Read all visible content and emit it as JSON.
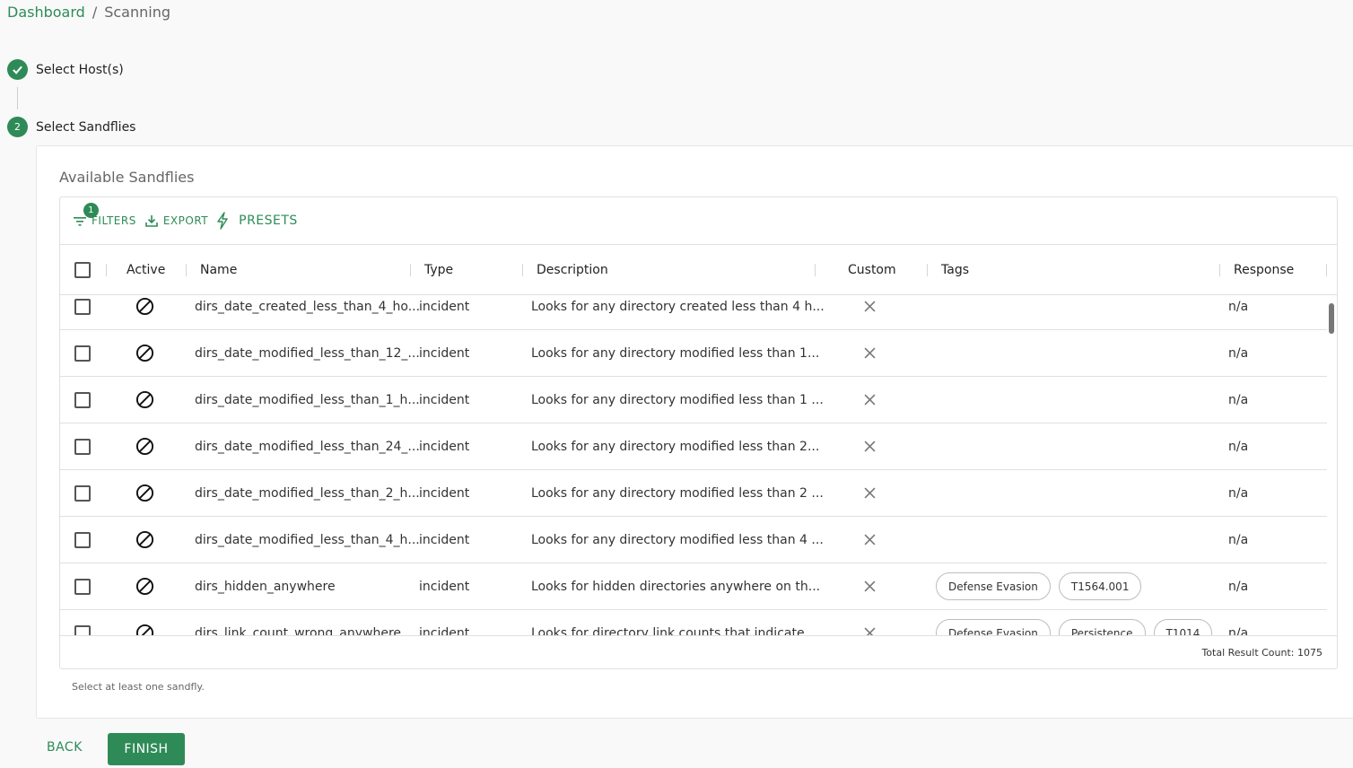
{
  "breadcrumb": {
    "link": "Dashboard",
    "separator": "/",
    "current": "Scanning"
  },
  "steps": [
    {
      "number": "",
      "label": "Select Host(s)",
      "status": "completed"
    },
    {
      "number": "2",
      "label": "Select Sandflies",
      "status": "active"
    }
  ],
  "panel": {
    "title": "Available Sandflies",
    "hint": "Select at least one sandfly."
  },
  "toolbar": {
    "filters_label": "FILTERS",
    "filters_badge": "1",
    "export_label": "EXPORT",
    "presets_label": "PRESETS"
  },
  "columns": {
    "active": "Active",
    "name": "Name",
    "type": "Type",
    "description": "Description",
    "custom": "Custom",
    "tags": "Tags",
    "response": "Response"
  },
  "rows": [
    {
      "active_icon": "disabled-icon",
      "name": "dirs_date_created_less_than_4_ho...",
      "type": "incident",
      "description": "Looks for any directory created less than 4 h...",
      "custom_icon": "x-icon",
      "tags": [],
      "response": "n/a"
    },
    {
      "active_icon": "disabled-icon",
      "name": "dirs_date_modified_less_than_12_...",
      "type": "incident",
      "description": "Looks for any directory modified less than 1...",
      "custom_icon": "x-icon",
      "tags": [],
      "response": "n/a"
    },
    {
      "active_icon": "disabled-icon",
      "name": "dirs_date_modified_less_than_1_h...",
      "type": "incident",
      "description": "Looks for any directory modified less than 1 ...",
      "custom_icon": "x-icon",
      "tags": [],
      "response": "n/a"
    },
    {
      "active_icon": "disabled-icon",
      "name": "dirs_date_modified_less_than_24_...",
      "type": "incident",
      "description": "Looks for any directory modified less than 2...",
      "custom_icon": "x-icon",
      "tags": [],
      "response": "n/a"
    },
    {
      "active_icon": "disabled-icon",
      "name": "dirs_date_modified_less_than_2_h...",
      "type": "incident",
      "description": "Looks for any directory modified less than 2 ...",
      "custom_icon": "x-icon",
      "tags": [],
      "response": "n/a"
    },
    {
      "active_icon": "disabled-icon",
      "name": "dirs_date_modified_less_than_4_h...",
      "type": "incident",
      "description": "Looks for any directory modified less than 4 ...",
      "custom_icon": "x-icon",
      "tags": [],
      "response": "n/a"
    },
    {
      "active_icon": "disabled-icon",
      "name": "dirs_hidden_anywhere",
      "type": "incident",
      "description": "Looks for hidden directories anywhere on th...",
      "custom_icon": "x-icon",
      "tags": [
        "Defense Evasion",
        "T1564.001"
      ],
      "response": "n/a"
    },
    {
      "active_icon": "disabled-icon",
      "name": "dirs_link_count_wrong_anywhere",
      "type": "incident",
      "description": "Looks for directory link counts that indicate ...",
      "custom_icon": "x-icon",
      "tags": [
        "Defense Evasion",
        "Persistence",
        "T1014"
      ],
      "response": "n/a"
    }
  ],
  "footer": {
    "total": "Total Result Count: 1075"
  },
  "actions": {
    "back_label": "BACK",
    "finish_label": "FINISH"
  },
  "colors": {
    "accent": "#2e8b57"
  }
}
